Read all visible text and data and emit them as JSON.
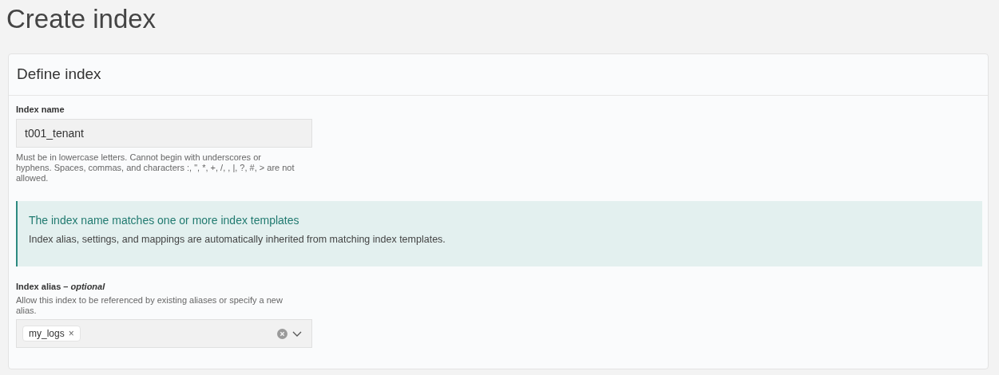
{
  "page_title": "Create index",
  "card": {
    "title": "Define index",
    "index_name": {
      "label": "Index name",
      "value": "t001_tenant",
      "help": "Must be in lowercase letters. Cannot begin with underscores or hyphens. Spaces, commas, and characters :, \", *, +, /, , |, ?, #, > are not allowed."
    },
    "callout": {
      "title": "The index name matches one or more index templates",
      "text": "Index alias, settings, and mappings are automatically inherited from matching index templates."
    },
    "index_alias": {
      "label": "Index alias – *optional*",
      "help": "Allow this index to be referenced by existing aliases or specify a new alias.",
      "tags": [
        {
          "label": "my_logs",
          "remove": "×"
        }
      ]
    }
  }
}
